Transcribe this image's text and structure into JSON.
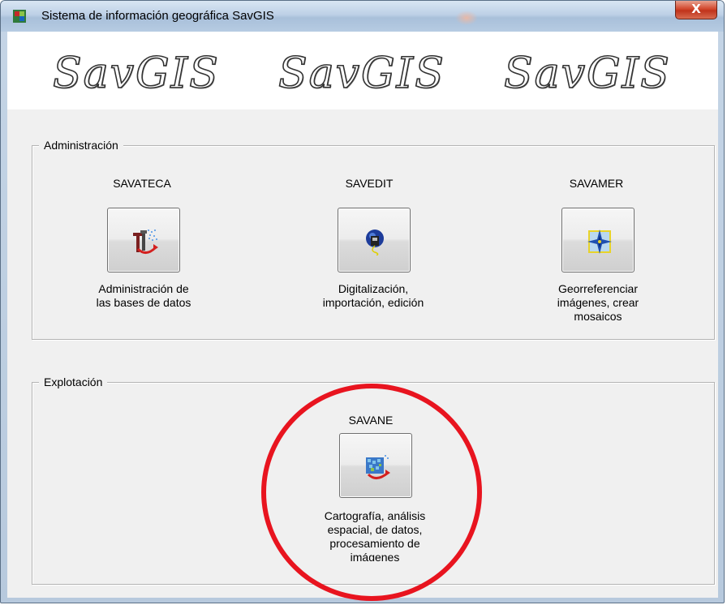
{
  "window": {
    "title": "Sistema de información geográfica SavGIS",
    "close_label": "X"
  },
  "banner": {
    "logos": [
      "SavGIS",
      "SavGIS",
      "SavGIS"
    ]
  },
  "admin": {
    "legend": "Administración",
    "modules": [
      {
        "title": "SAVATECA",
        "desc_lines": [
          "Administración de",
          "las bases de datos"
        ],
        "icon": "savateca-icon"
      },
      {
        "title": "SAVEDIT",
        "desc_lines": [
          "Digitalización,",
          "importación, edición"
        ],
        "icon": "savedit-icon"
      },
      {
        "title": "SAVAMER",
        "desc_lines": [
          "Georreferenciar",
          "imágenes, crear",
          "mosaicos"
        ],
        "icon": "savamer-icon"
      }
    ]
  },
  "exploit": {
    "legend": "Explotación",
    "modules": [
      {
        "title": "SAVANE",
        "desc_lines": [
          "Cartografía, análisis",
          "espacial, de datos,",
          "procesamiento de",
          "imágenes"
        ],
        "icon": "savane-icon"
      }
    ]
  },
  "annotation": {
    "color": "#e8141f"
  }
}
